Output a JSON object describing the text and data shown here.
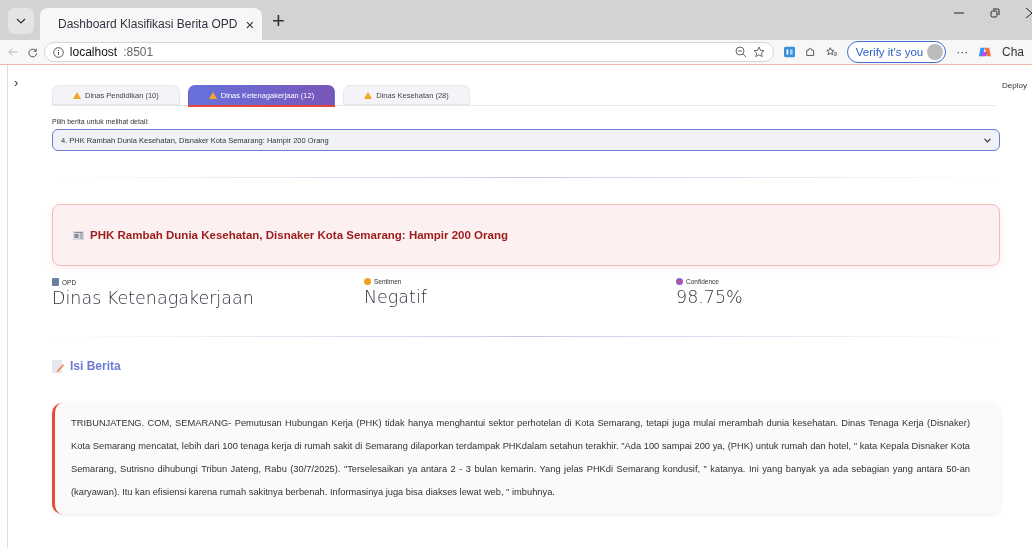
{
  "browser": {
    "tab_title": "Dashboard Klasifikasi Berita OPD",
    "tab_close": "×",
    "new_tab": "+",
    "address_host": "localhost",
    "address_port": ":8501",
    "verify_button": "Verify it's you",
    "more": "···",
    "copilot_label": "Cha"
  },
  "app": {
    "sidebar_toggle": "›",
    "deploy": "Deploy",
    "tabs": [
      {
        "label": "Dinas Pendidikan (10)",
        "selected": false
      },
      {
        "label": "Dinas Ketenagakerjaan (12)",
        "selected": true
      },
      {
        "label": "Dinas Kesehatan (28)",
        "selected": false
      }
    ],
    "select": {
      "label": "Pilih berita untuk melihat detail:",
      "value": "4. PHK Rambah Dunia Kesehatan, Disnaker Kota Semarang: Hampir 200 Orang"
    },
    "headline": "PHK Rambah Dunia Kesehatan, Disnaker Kota Semarang: Hampir 200 Orang",
    "metrics": [
      {
        "kind": "opd",
        "label": "OPD",
        "value": "Dinas Ketenagakerjaan"
      },
      {
        "kind": "sentiment",
        "label": "Sentimen",
        "value": "Negatif"
      },
      {
        "kind": "confidence",
        "label": "Confidence",
        "value": "98.75%"
      }
    ],
    "section_title": "Isi Berita",
    "article": "TRIBUNJATENG. COM, SEMARANG- Pemutusan Hubungan Kerja (PHK) tidak hanya menghantui sektor perhotelan di Kota Semarang, tetapi juga mulai merambah dunia kesehatan. Dinas Tenaga Kerja (Disnaker) Kota Semarang mencatat, lebih dari 100 tenaga kerja di rumah sakit di Semarang dilaporkan terdampak PHKdalam setahun terakhir. \"Ada 100 sampai 200 ya, (PHK) untuk rumah dan hotel, \" kata Kepala Disnaker Kota Semarang, Sutrisno dihubungi Tribun Jateng, Rabu (30/7/2025). \"Terselesaikan ya antara 2 - 3 bulan kemarin. Yang jelas PHKdi Semarang kondusif, \" katanya. Ini yang banyak ya ada sebagian yang antara 50-an (karyawan). Itu kan efisiensi karena rumah sakitnya berbenah. Informasinya juga bisa diakses lewat web, \" imbuhnya."
  }
}
